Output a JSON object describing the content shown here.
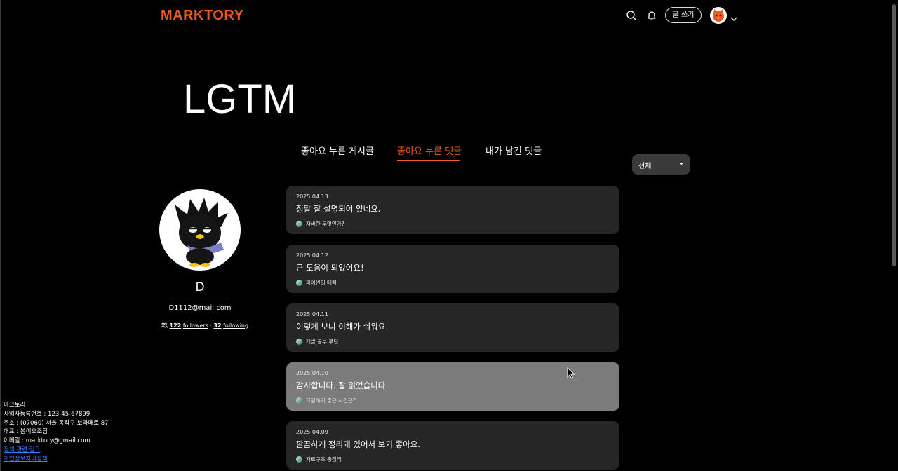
{
  "header": {
    "logo": "MARKTORY",
    "write_label": "글 쓰기"
  },
  "page_title": "LGTM",
  "tabs": [
    {
      "label": "좋아요 누른 게시글",
      "active": false
    },
    {
      "label": "좋아요 누른 댓글",
      "active": true
    },
    {
      "label": "내가 남긴 댓글",
      "active": false
    }
  ],
  "filter": {
    "selected": "전체"
  },
  "profile": {
    "name": "D",
    "email": "D1112@mail.com",
    "followers_count": "122",
    "followers_label": "followers",
    "separator": "·",
    "following_count": "32",
    "following_label": "following"
  },
  "comments": [
    {
      "date": "2025.04.13",
      "text": "정말 잘 설명되어 있네요.",
      "post": "자바란 무엇인가?"
    },
    {
      "date": "2025.04.12",
      "text": "큰 도움이 되었어요!",
      "post": "파이썬의 매력"
    },
    {
      "date": "2025.04.11",
      "text": "이렇게 보니 이해가 쉬워요.",
      "post": "개발 공부 루틴"
    },
    {
      "date": "2025.04.10",
      "text": "감사합니다. 잘 읽었습니다.",
      "post": "코딩하기 좋은 시간은?"
    },
    {
      "date": "2025.04.09",
      "text": "깔끔하게 정리돼 있어서 보기 좋아요.",
      "post": "자료구조 총정리"
    }
  ],
  "footer": {
    "company": "마크토리",
    "biz_no": "사업자등록번호 : 123-45-67899",
    "address": "주소 : (07060) 서울 동작구 보라매로 87",
    "ceo": "대표 : 봄이오조팀",
    "email": "이메일 : marktory@gmail.com",
    "link1": "정책 관련 링크",
    "link2": "개인정보처리정책"
  },
  "colors": {
    "accent": "#f05a1e",
    "card": "#262626",
    "card_hover": "#7b7b7b"
  }
}
